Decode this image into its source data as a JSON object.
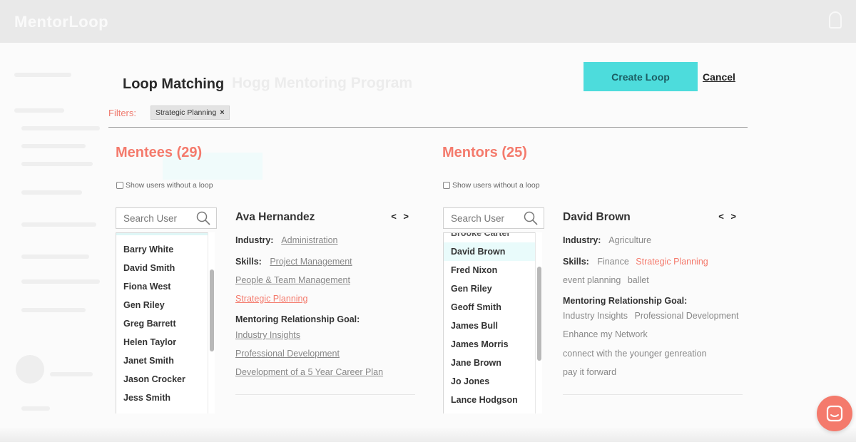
{
  "app": {
    "brand": "MentorLoop"
  },
  "modal": {
    "title": "Loop Matching",
    "background_title": "Hogg Mentoring Program",
    "create_label": "Create Loop",
    "cancel_label": "Cancel",
    "filters_label": "Filters:",
    "filters": [
      {
        "label": "Strategic Planning"
      }
    ],
    "accent_color": "#4ddcdc",
    "highlight_color": "#f47a6c"
  },
  "mentees": {
    "title": "Mentees (29)",
    "show_without_loop": "Show users without a loop",
    "search_placeholder": "Search User",
    "list": [
      "Barry White",
      "David Smith",
      "Fiona West",
      "Gen Riley",
      "Greg Barrett",
      "Helen Taylor",
      "Janet Smith",
      "Jason Crocker",
      "Jess Smith"
    ],
    "detail": {
      "name": "Ava Hernandez",
      "nav": "< >",
      "industry_label": "Industry:",
      "industry": "Administration",
      "skills_label": "Skills:",
      "skills": [
        "Project Management",
        "People & Team Management",
        "Strategic Planning"
      ],
      "goal_label": "Mentoring Relationship Goal:",
      "goals": [
        "Industry Insights",
        "Professional Development",
        "Development of a 5 Year Career Plan"
      ]
    }
  },
  "mentors": {
    "title": "Mentors (25)",
    "show_without_loop": "Show users without a loop",
    "search_placeholder": "Search User",
    "partial_top": "Brooke Carter",
    "list": [
      "David Brown",
      "Fred Nixon",
      "Gen Riley",
      "Geoff Smith",
      "James Bull",
      "James Morris",
      "Jane Brown",
      "Jo Jones",
      "Lance Hodgson"
    ],
    "detail": {
      "name": "David Brown",
      "nav": "< >",
      "industry_label": "Industry:",
      "industry": "Agriculture",
      "skills_label": "Skills:",
      "skills": [
        "Finance",
        "Strategic Planning",
        "event planning",
        "ballet"
      ],
      "goal_label": "Mentoring Relationship Goal:",
      "goals": [
        "Industry Insights",
        "Professional Development",
        "Enhance my Network",
        "connect with the younger genreation",
        "pay it forward"
      ]
    }
  }
}
